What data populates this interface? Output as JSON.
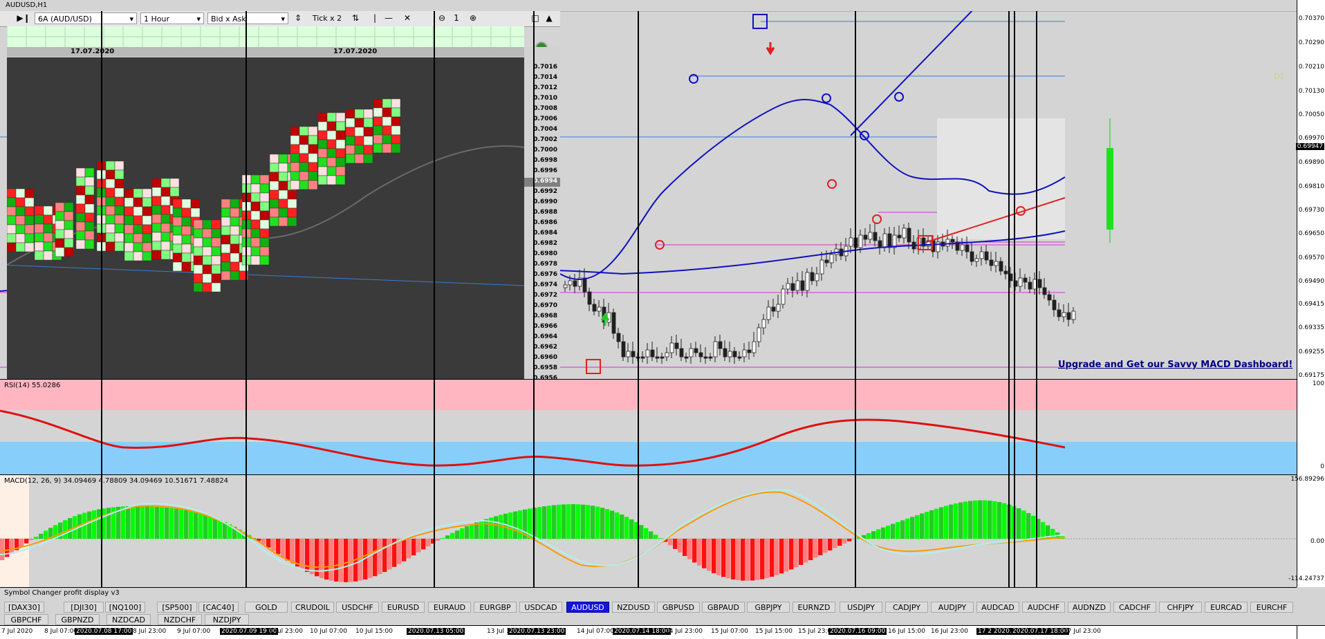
{
  "window": {
    "title": "AUDUSD,H1"
  },
  "orderflow": {
    "symbol": "6A (AUD/USD)",
    "timeframe": "1 Hour",
    "mode": "Bid x Ask",
    "tick": "Tick x 2",
    "minimize_label": "—",
    "close_label": "✕",
    "counter": "1",
    "dates": [
      "17.07.2020",
      "17.07.2020"
    ],
    "ladder": [
      "0.7016",
      "0.7014",
      "0.7012",
      "0.7010",
      "0.7008",
      "0.7006",
      "0.7004",
      "0.7002",
      "0.7000",
      "0.6998",
      "0.6996",
      "0.6994",
      "0.6992",
      "0.6990",
      "0.6988",
      "0.6986",
      "0.6984",
      "0.6982",
      "0.6980",
      "0.6978",
      "0.6976",
      "0.6974",
      "0.6972",
      "0.6970",
      "0.6968",
      "0.6966",
      "0.6964",
      "0.6962",
      "0.6960",
      "0.6958",
      "0.6956"
    ],
    "ladder_current": "0.6994"
  },
  "price_axis": {
    "labels": [
      "0.70370",
      "0.70290",
      "0.70210",
      "0.70130",
      "0.70050",
      "0.69970",
      "0.69947",
      "0.69890",
      "0.69810",
      "0.69730",
      "0.69650",
      "0.69570",
      "0.69490",
      "0.69415",
      "0.69335",
      "0.69255",
      "0.69175"
    ],
    "current_price": "0.69947"
  },
  "chart": {
    "timeframe_tag": "D1",
    "upgrade_text": "Upgrade and Get our Savvy MACD Dashboard!"
  },
  "rsi": {
    "label": "RSI(14) 55.0286",
    "axis": [
      "100",
      "0"
    ]
  },
  "macd": {
    "label": "MACD(12, 26, 9) 34.09469 4.78809 34.09469 10.51671 7.48824",
    "axis": [
      "156.89296",
      "0.00",
      "-114.24737"
    ]
  },
  "symbol_changer": {
    "title": "Symbol Changer profit display v3",
    "active": "AUDUSD",
    "row1": [
      "[DAX30]",
      "[DJI30]",
      "[NQ100]",
      "[SP500]",
      "[CAC40]",
      "GOLD",
      "CRUDOIL",
      "USDCHF",
      "EURUSD",
      "EURAUD",
      "EURGBP",
      "USDCAD",
      "AUDUSD",
      "NZDUSD",
      "GBPUSD",
      "GBPAUD",
      "GBPJPY",
      "EURNZD",
      "USDJPY",
      "CADJPY",
      "AUDJPY",
      "AUDCAD",
      "AUDCHF",
      "AUDNZD",
      "CADCHF",
      "CHFJPY",
      "EURCAD",
      "EURCHF"
    ],
    "row2": [
      "GBPCHF",
      "GBPNZD",
      "NZDCAD",
      "NZDCHF",
      "NZDJPY"
    ]
  },
  "time_axis": [
    {
      "text": "7 Jul 2020",
      "hl": false
    },
    {
      "text": "8 Jul 07:00",
      "hl": false
    },
    {
      "text": "2020.07.08 17:00",
      "hl": true
    },
    {
      "text": "8 Jul 23:00",
      "hl": false
    },
    {
      "text": "9 Jul 07:00",
      "hl": false
    },
    {
      "text": "2020.07.09 19:00",
      "hl": true
    },
    {
      "text": "10 Jul 23:00",
      "hl": false
    },
    {
      "text": "10 Jul 07:00",
      "hl": false
    },
    {
      "text": "10 Jul 15:00",
      "hl": false
    },
    {
      "text": "2020.07.13 05:00",
      "hl": true
    },
    {
      "text": "13 Jul 15:00",
      "hl": false
    },
    {
      "text": "2020.07.13 23:00",
      "hl": true
    },
    {
      "text": "14 Jul 07:00",
      "hl": false
    },
    {
      "text": "2020.07.14 18:00",
      "hl": true
    },
    {
      "text": "14 Jul 23:00",
      "hl": false
    },
    {
      "text": "15 Jul 07:00",
      "hl": false
    },
    {
      "text": "15 Jul 15:00",
      "hl": false
    },
    {
      "text": "15 Jul 23:00",
      "hl": false
    },
    {
      "text": "2020.07.16 09:00",
      "hl": true
    },
    {
      "text": "16 Jul 15:00",
      "hl": false
    },
    {
      "text": "16 Jul 23:00",
      "hl": false
    },
    {
      "text": "17 2 2020.0",
      "hl": true
    },
    {
      "text": "2020.07.17 18:00",
      "hl": true
    },
    {
      "text": "17 Jul 23:00",
      "hl": false
    }
  ],
  "colors": {
    "panel_bg": "#d4d4d4",
    "active_symbol": "#1515d8",
    "rsi_upper": "#ffb6c1",
    "rsi_lower": "#87cefa",
    "macd_up": "#00ff00",
    "macd_down": "#ff0000"
  }
}
